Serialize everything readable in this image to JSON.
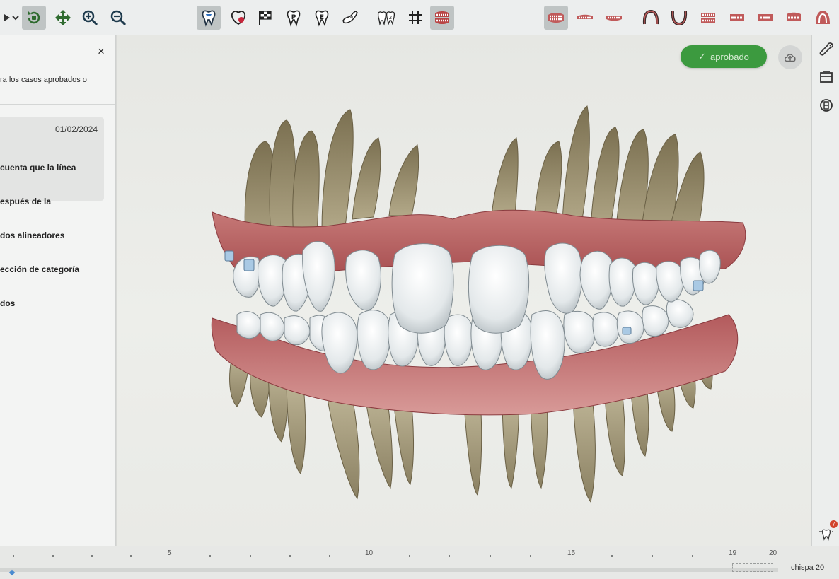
{
  "toolbar": {
    "left_tools": [
      "play-dropdown-icon",
      "rotate-icon",
      "pan-icon",
      "zoom-in-icon",
      "zoom-out-icon"
    ],
    "view_tools": [
      "tooth-icon",
      "gums-icon",
      "checkered-flag-icon",
      "tooth-p-icon",
      "tooth-e-icon",
      "attachment-icon",
      "tooth-numbers-icon",
      "grid-icon",
      "occlusion-icon"
    ],
    "active_view_tool": "tooth-icon",
    "orientation_tools": [
      "front-view-icon",
      "upper-front-view-icon",
      "lower-front-view-icon",
      "upper-arch-icon",
      "lower-arch-icon",
      "left-view-icon",
      "right-side-view-icon",
      "left-side-view-icon",
      "back-view-icon",
      "palate-view-icon"
    ]
  },
  "left_panel": {
    "close_label": "×",
    "notice": "ra los casos aprobados o",
    "comment": {
      "date": "01/02/2024",
      "lines": [
        "cuenta que la línea",
        "espués de la",
        "dos alineadores",
        "ección de categoría",
        "dos"
      ]
    }
  },
  "viewport": {
    "status_label": "aprobado",
    "status_color": "#3c9a3f",
    "upload_icon": "cloud-upload-icon"
  },
  "right_rail": {
    "tools": [
      "wrench-icon",
      "layers-icon",
      "stages-icon"
    ],
    "bottom_tool": "tooth-measure-icon",
    "bottom_badge": "7"
  },
  "timeline": {
    "tick_labels": [
      "5",
      "10",
      "15",
      "19",
      "20"
    ],
    "stage_label": "chispa 20"
  }
}
